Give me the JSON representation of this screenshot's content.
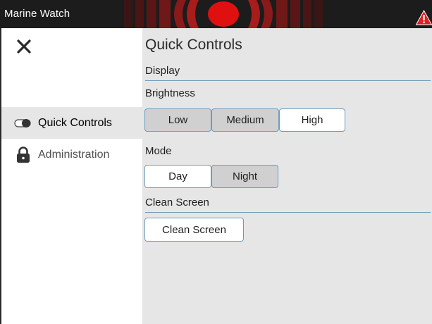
{
  "app": {
    "title": "Marine Watch",
    "alarm_color": "#e01010",
    "warning_color": "#e02020"
  },
  "sidebar": {
    "items": [
      {
        "label": "Quick Controls",
        "icon": "toggle-icon",
        "active": true
      },
      {
        "label": "Administration",
        "icon": "lock-icon",
        "active": false
      }
    ]
  },
  "main": {
    "title": "Quick Controls",
    "display": {
      "header": "Display",
      "brightness_label": "Brightness",
      "brightness_options": [
        "Low",
        "Medium",
        "High"
      ],
      "brightness_selected": "High",
      "mode_label": "Mode",
      "mode_options": [
        "Day",
        "Night"
      ],
      "mode_selected": "Day"
    },
    "clean": {
      "header": "Clean Screen",
      "button_label": "Clean Screen"
    }
  }
}
